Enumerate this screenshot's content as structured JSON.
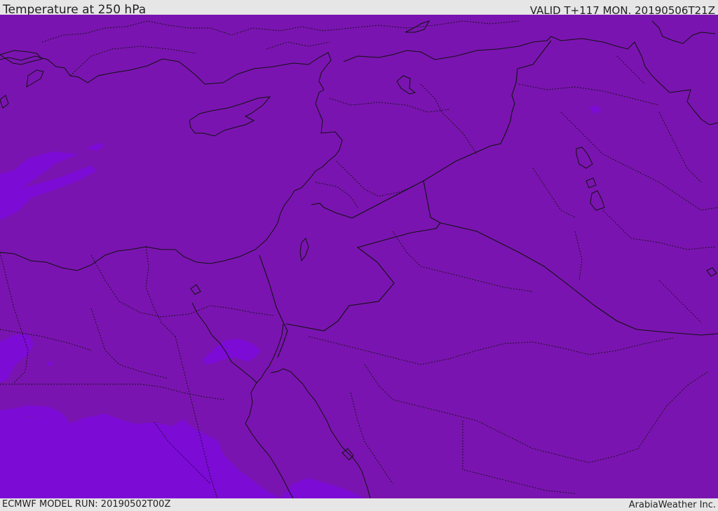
{
  "header": {
    "title": "Temperature at 250 hPa",
    "valid_time": "VALID T+117 MON. 20190506T21Z"
  },
  "footer": {
    "model_run": "ECMWF MODEL RUN: 20190502T00Z",
    "credit": "ArabiaWeather Inc."
  },
  "colors": {
    "base_fill": "#7a14b0",
    "warmer_patch": "#7c0bd6",
    "border_line": "#111111",
    "header_bg": "#e6e6e6"
  }
}
